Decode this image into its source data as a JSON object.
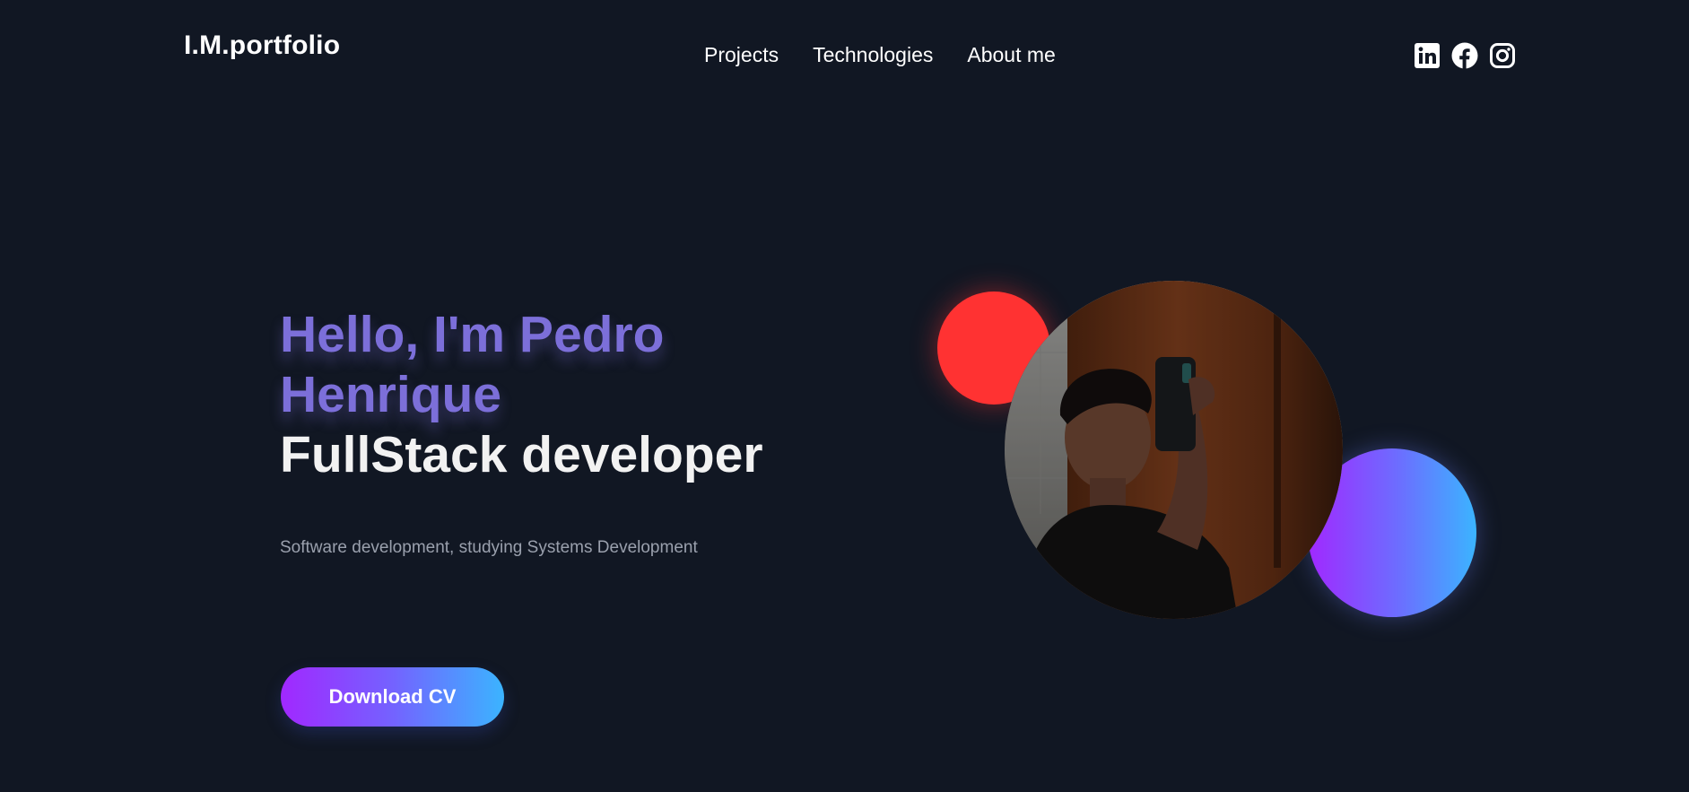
{
  "header": {
    "logo": "I.M.portfolio",
    "nav": [
      {
        "label": "Projects"
      },
      {
        "label": "Technologies"
      },
      {
        "label": "About me"
      }
    ],
    "socials": [
      {
        "icon": "linkedin-icon"
      },
      {
        "icon": "facebook-icon"
      },
      {
        "icon": "instagram-icon"
      }
    ]
  },
  "hero": {
    "greeting": "Hello, I'm Pedro Henrique",
    "role": "FullStack developer",
    "subtitle": "Software development, studying Systems Development",
    "cta_label": "Download CV"
  },
  "colors": {
    "background": "#111723",
    "greeting": "#7c6fd9",
    "accent_red": "#ff3232",
    "gradient_start": "#a128ff",
    "gradient_end": "#3bb4ff"
  }
}
